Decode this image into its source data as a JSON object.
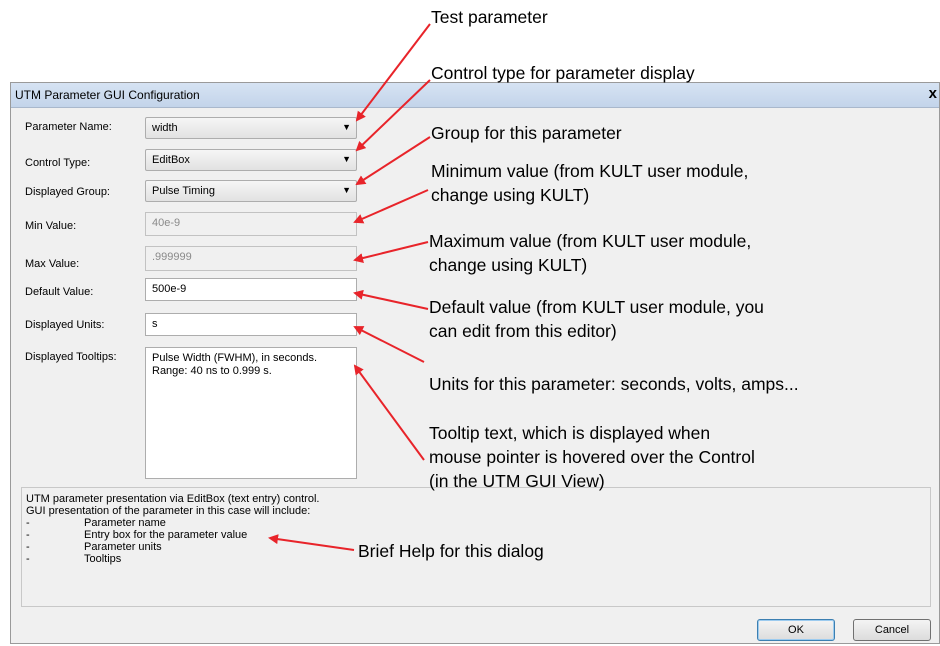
{
  "dialog": {
    "title": "UTM Parameter GUI Configuration",
    "close_label": "x",
    "fields": {
      "parameter_name": {
        "label": "Parameter Name:",
        "value": "width"
      },
      "control_type": {
        "label": "Control Type:",
        "value": "EditBox"
      },
      "displayed_group": {
        "label": "Displayed Group:",
        "value": "Pulse Timing"
      },
      "min_value": {
        "label": "Min Value:",
        "value": "40e-9"
      },
      "max_value": {
        "label": "Max Value:",
        "value": ".999999"
      },
      "default_value": {
        "label": "Default Value:",
        "value": "500e-9"
      },
      "displayed_units": {
        "label": "Displayed Units:",
        "value": "s"
      },
      "displayed_tooltips": {
        "label": "Displayed Tooltips:",
        "lines": [
          "Pulse Width (FWHM), in seconds.",
          "Range: 40 ns to 0.999 s."
        ]
      }
    },
    "help": {
      "lines": [
        "UTM parameter presentation via EditBox (text entry) control.",
        "GUI presentation of the parameter in this case will include:"
      ],
      "items": [
        "Parameter name",
        "Entry box for the parameter value",
        "Parameter units",
        "Tooltips"
      ],
      "bullet": "-"
    },
    "buttons": {
      "ok": "OK",
      "cancel": "Cancel"
    }
  },
  "annotations": {
    "test_parameter": [
      "Test parameter"
    ],
    "control_type": [
      "Control type for parameter display"
    ],
    "group": [
      "Group for this parameter"
    ],
    "minimum": [
      "Minimum value (from KULT user module,",
      "change using KULT)"
    ],
    "maximum": [
      "Maximum value (from KULT user module,",
      "change using KULT)"
    ],
    "default": [
      "Default value (from KULT user module, you",
      "can edit from this editor)"
    ],
    "units": [
      "Units for this parameter: seconds, volts, amps..."
    ],
    "tooltip": [
      "Tooltip text, which is displayed when",
      "mouse pointer is hovered over the Control",
      "(in the UTM GUI View)"
    ],
    "help": [
      "Brief Help for this dialog"
    ]
  },
  "colors": {
    "arrow": "#e8242a"
  },
  "icons": {
    "dropdown": "chevron-down-icon",
    "close": "close-icon"
  }
}
